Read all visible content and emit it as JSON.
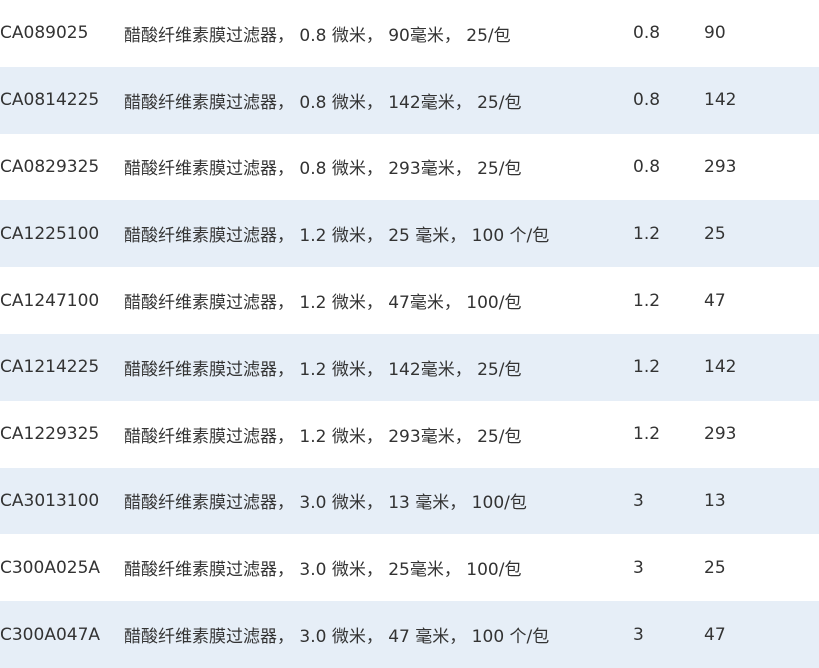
{
  "table": {
    "rows": [
      {
        "code": "CA089025",
        "description": "醋酸纤维素膜过滤器， 0.8 微米， 90毫米， 25/包",
        "pore": "0.8",
        "diameter": "90"
      },
      {
        "code": "CA0814225",
        "description": "醋酸纤维素膜过滤器， 0.8 微米， 142毫米， 25/包",
        "pore": "0.8",
        "diameter": "142"
      },
      {
        "code": "CA0829325",
        "description": "醋酸纤维素膜过滤器， 0.8 微米， 293毫米， 25/包",
        "pore": "0.8",
        "diameter": "293"
      },
      {
        "code": "CA1225100",
        "description": "醋酸纤维素膜过滤器， 1.2 微米， 25 毫米， 100 个/包",
        "pore": "1.2",
        "diameter": "25"
      },
      {
        "code": "CA1247100",
        "description": "醋酸纤维素膜过滤器， 1.2 微米， 47毫米， 100/包",
        "pore": "1.2",
        "diameter": "47"
      },
      {
        "code": "CA1214225",
        "description": "醋酸纤维素膜过滤器， 1.2 微米， 142毫米， 25/包",
        "pore": "1.2",
        "diameter": "142"
      },
      {
        "code": "CA1229325",
        "description": "醋酸纤维素膜过滤器， 1.2 微米， 293毫米， 25/包",
        "pore": "1.2",
        "diameter": "293"
      },
      {
        "code": "CA3013100",
        "description": "醋酸纤维素膜过滤器， 3.0 微米， 13 毫米， 100/包",
        "pore": "3",
        "diameter": "13"
      },
      {
        "code": "C300A025A",
        "description": "醋酸纤维素膜过滤器， 3.0 微米， 25毫米， 100/包",
        "pore": "3",
        "diameter": "25"
      },
      {
        "code": "C300A047A",
        "description": "醋酸纤维素膜过滤器， 3.0 微米， 47 毫米， 100 个/包",
        "pore": "3",
        "diameter": "47"
      }
    ]
  },
  "colors": {
    "row_shade": "#e6eef7",
    "text": "#333333",
    "background": "#ffffff"
  }
}
